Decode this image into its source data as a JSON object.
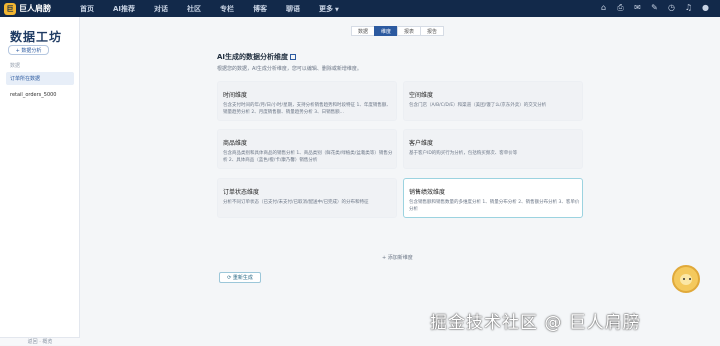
{
  "brand": {
    "badge": "巨",
    "name": "巨人肩膀"
  },
  "nav": {
    "items": [
      {
        "label": "首页"
      },
      {
        "label": "AI推荐"
      },
      {
        "label": "对话"
      },
      {
        "label": "社区"
      },
      {
        "label": "专栏"
      },
      {
        "label": "博客"
      },
      {
        "label": "聊语"
      },
      {
        "label": "更多"
      }
    ],
    "icons": [
      "home-icon",
      "print-icon",
      "mail-icon",
      "edit-icon",
      "clock-icon",
      "bell-icon",
      "avatar"
    ]
  },
  "sidebar": {
    "title": "数据工坊",
    "add_button": "+ 数据分析",
    "section_label": "数据",
    "items": [
      {
        "label": "订单所在数据"
      },
      {
        "label": "retail_orders_5000"
      }
    ],
    "bottom_label": "返回 · 概览"
  },
  "tabs": [
    {
      "label": "数据"
    },
    {
      "label": "维度"
    },
    {
      "label": "报表"
    },
    {
      "label": "报告"
    }
  ],
  "panel": {
    "title": "AI生成的数据分析维度",
    "desc": "根据您的数据，AI生成分析维度，您可以编辑、删除或新增维度。",
    "add_dimension": "+ 添加新维度",
    "regenerate": "⟳ 重新生成"
  },
  "cards": [
    {
      "title": "时间维度",
      "desc": "包含支付时间的年/月/日/小时/星期，支持分析销售趋势和时段特征 1、年度销售额、销量趋势分析 2、月度销售额、销量趋势分析 3、日销售额..."
    },
    {
      "title": "空间维度",
      "desc": "包含门店（A/B/C/D/E）和渠道（美团/饿了么/京东外卖）的交叉分析"
    },
    {
      "title": "商品维度",
      "desc": "包含商品类别和具体商品的销售分析 1、商品类别（鲜花类/绿植类/盆栽类等）销售分析 2、具体商品（蓝色/橙/卡/康乃馨）销售分析"
    },
    {
      "title": "客户维度",
      "desc": "基于客户ID的购买行为分析，包括购买频次、客单价等"
    },
    {
      "title": "订单状态维度",
      "desc": "分析不同订单状态（已支付/未支付/已取消/配送中/已完成）的分布和特征"
    },
    {
      "title": "销售绩效维度",
      "desc": "包含销售额和销售数量的多维度分析 1、销量分布分析 2、销售额分布分析 3、客单价分析"
    }
  ],
  "watermark": "掘金技术社区 @ 巨人肩膀"
}
